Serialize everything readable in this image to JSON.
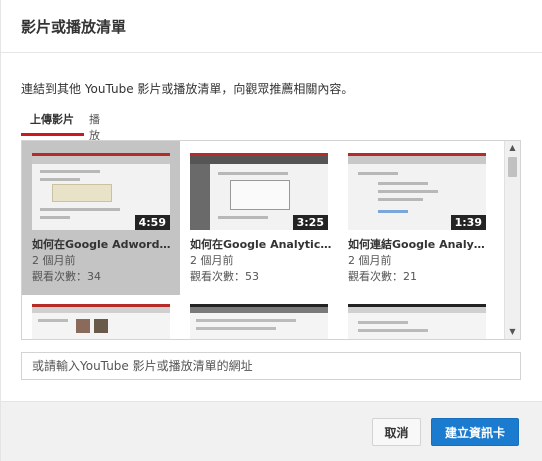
{
  "dialog": {
    "title": "影片或播放清單",
    "description": "連結到其他 YouTube 影片或播放清單，向觀眾推薦相關內容。"
  },
  "tabs": [
    {
      "label": "上傳影片",
      "active": true
    },
    {
      "label": "播放清單",
      "active": false
    }
  ],
  "videos": [
    {
      "title": "如何在Google Adwords…",
      "duration": "4:59",
      "age": "2 個月前",
      "views": "觀看次數：34",
      "selected": true
    },
    {
      "title": "如何在Google Analytic…",
      "duration": "3:25",
      "age": "2 個月前",
      "views": "觀看次數：53",
      "selected": false
    },
    {
      "title": "如何連結Google Analy…",
      "duration": "1:39",
      "age": "2 個月前",
      "views": "觀看次數：21",
      "selected": false
    }
  ],
  "url_input": {
    "placeholder": "或請輸入YouTube 影片或播放清單的網址",
    "value": ""
  },
  "footer": {
    "cancel_label": "取消",
    "create_label": "建立資訊卡"
  },
  "colors": {
    "accent_blue": "#1b7bce",
    "tab_underline": "#cc181e",
    "selected_bg": "#c4c4c4"
  },
  "icons": {
    "scroll_up": "scroll-up-arrow-icon",
    "scroll_down": "scroll-down-arrow-icon"
  }
}
